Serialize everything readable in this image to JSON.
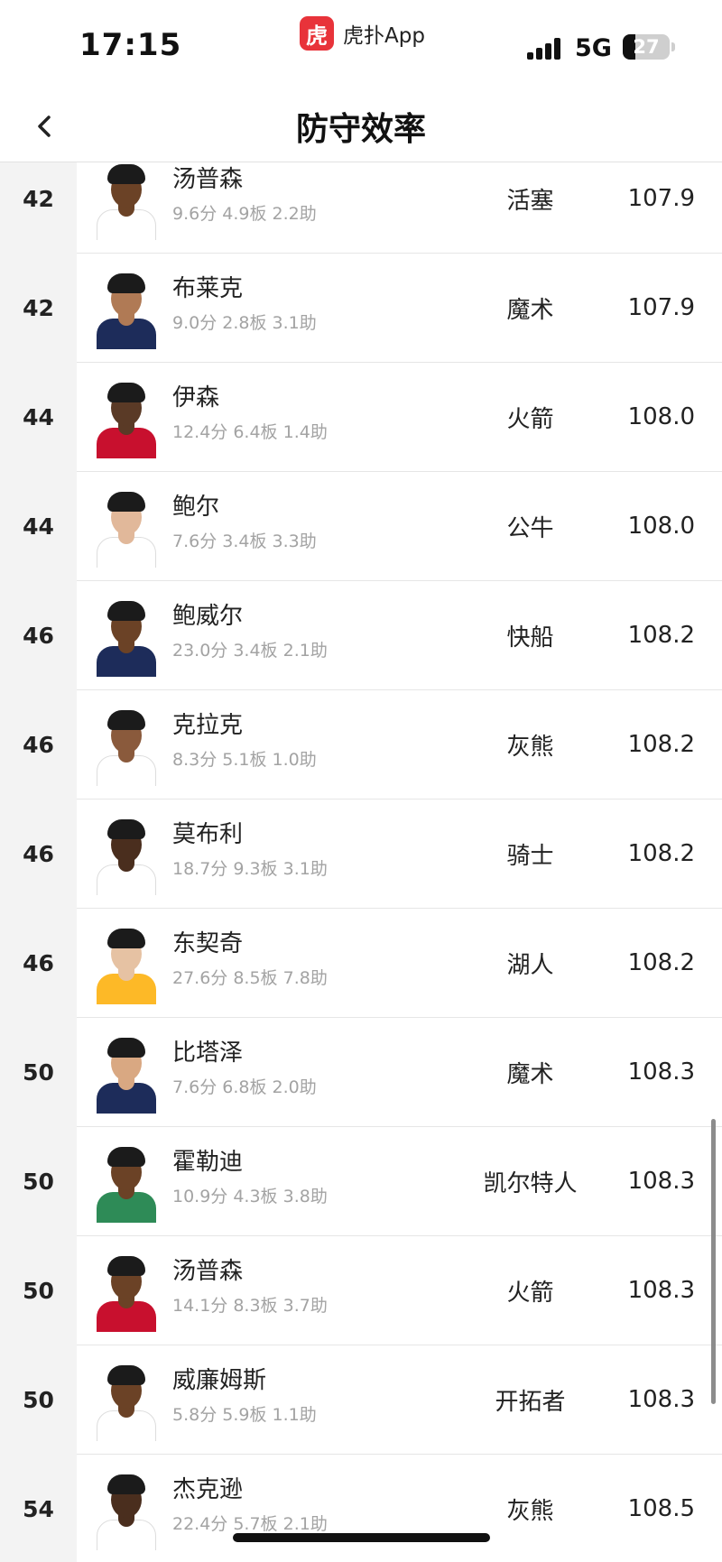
{
  "status_bar": {
    "time": "17:15",
    "app_logo_char": "虎",
    "app_name": "虎扑App",
    "network": "5G",
    "battery_percent": 27,
    "battery_text": "27"
  },
  "nav": {
    "title": "防守效率",
    "back_icon": "chevron-left-icon"
  },
  "rows": [
    {
      "rank": "42",
      "name": "汤普森",
      "stats": "9.6分  4.9板  2.2助",
      "team": "活塞",
      "value": "107.9"
    },
    {
      "rank": "42",
      "name": "布莱克",
      "stats": "9.0分  2.8板  3.1助",
      "team": "魔术",
      "value": "107.9"
    },
    {
      "rank": "44",
      "name": "伊森",
      "stats": "12.4分  6.4板  1.4助",
      "team": "火箭",
      "value": "108.0"
    },
    {
      "rank": "44",
      "name": "鲍尔",
      "stats": "7.6分  3.4板  3.3助",
      "team": "公牛",
      "value": "108.0"
    },
    {
      "rank": "46",
      "name": "鲍威尔",
      "stats": "23.0分  3.4板  2.1助",
      "team": "快船",
      "value": "108.2"
    },
    {
      "rank": "46",
      "name": "克拉克",
      "stats": "8.3分  5.1板  1.0助",
      "team": "灰熊",
      "value": "108.2"
    },
    {
      "rank": "46",
      "name": "莫布利",
      "stats": "18.7分  9.3板  3.1助",
      "team": "骑士",
      "value": "108.2"
    },
    {
      "rank": "46",
      "name": "东契奇",
      "stats": "27.6分  8.5板  7.8助",
      "team": "湖人",
      "value": "108.2"
    },
    {
      "rank": "50",
      "name": "比塔泽",
      "stats": "7.6分  6.8板  2.0助",
      "team": "魔术",
      "value": "108.3"
    },
    {
      "rank": "50",
      "name": "霍勒迪",
      "stats": "10.9分  4.3板  3.8助",
      "team": "凯尔特人",
      "value": "108.3"
    },
    {
      "rank": "50",
      "name": "汤普森",
      "stats": "14.1分  8.3板  3.7助",
      "team": "火箭",
      "value": "108.3"
    },
    {
      "rank": "50",
      "name": "威廉姆斯",
      "stats": "5.8分  5.9板  1.1助",
      "team": "开拓者",
      "value": "108.3"
    },
    {
      "rank": "54",
      "name": "杰克逊",
      "stats": "22.4分  5.7板  2.1助",
      "team": "灰熊",
      "value": "108.5"
    }
  ],
  "colors": {
    "app_red": "#e8333a",
    "rank_column_bg": "#f3f3f3",
    "stats_gray": "#a3a3a3",
    "jerseys": [
      "#ffffff",
      "#1d2c5a",
      "#c8102e",
      "#ffffff",
      "#1d2c5a",
      "#ffffff",
      "#ffffff",
      "#fdb927",
      "#1d2c5a",
      "#2e8b57",
      "#c8102e",
      "#ffffff",
      "#ffffff"
    ],
    "skins": [
      "#6b4226",
      "#b07a55",
      "#5a3a26",
      "#e1b89a",
      "#6b4226",
      "#8a5a3c",
      "#4a2e1e",
      "#e6c2a3",
      "#d9a882",
      "#6b4226",
      "#6b4226",
      "#6b4226",
      "#4a2e1e"
    ]
  }
}
